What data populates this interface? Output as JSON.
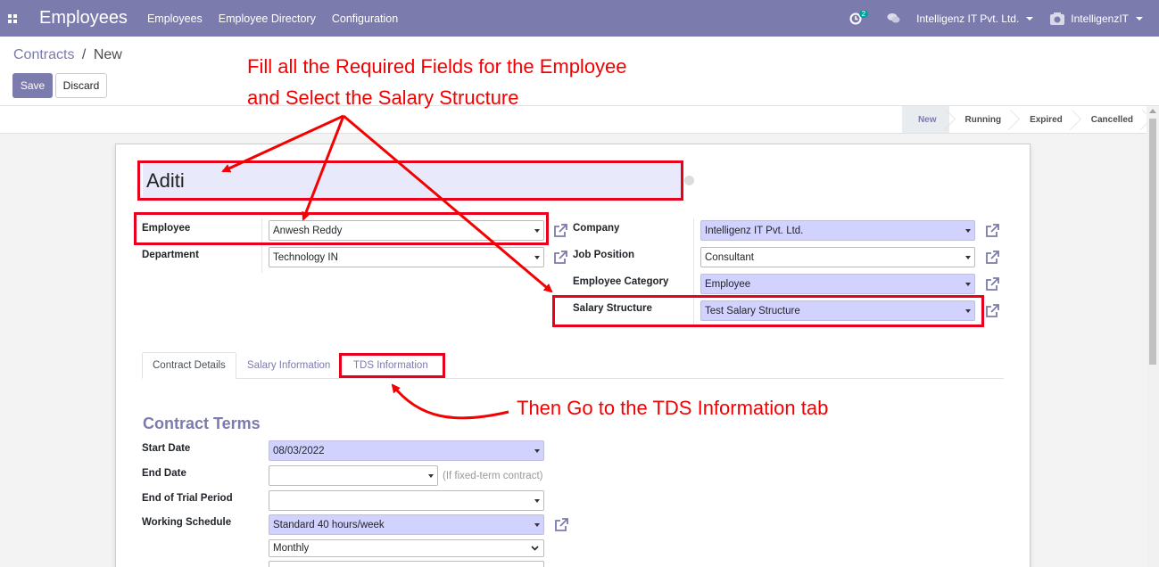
{
  "navbar": {
    "app_title": "Employees",
    "menu": [
      "Employees",
      "Employee Directory",
      "Configuration"
    ],
    "activity_badge": "2",
    "company": "Intelligenz IT Pvt. Ltd.",
    "user": "IntelligenzIT",
    "color": "#7c7bad"
  },
  "breadcrumb": {
    "parent": "Contracts",
    "separator": "/",
    "current": "New"
  },
  "buttons": {
    "save": "Save",
    "discard": "Discard"
  },
  "status_stages": [
    "New",
    "Running",
    "Expired",
    "Cancelled"
  ],
  "form": {
    "name": "Aditi",
    "employee": {
      "label": "Employee",
      "value": "Anwesh Reddy"
    },
    "department": {
      "label": "Department",
      "value": "Technology IN"
    },
    "company": {
      "label": "Company",
      "value": "Intelligenz IT Pvt. Ltd."
    },
    "job_position": {
      "label": "Job Position",
      "value": "Consultant"
    },
    "employee_category": {
      "label": "Employee Category",
      "value": "Employee"
    },
    "salary_structure": {
      "label": "Salary Structure",
      "value": "Test Salary Structure"
    }
  },
  "tabs": [
    "Contract Details",
    "Salary Information",
    "TDS Information"
  ],
  "contract_terms": {
    "title": "Contract Terms",
    "start_date": {
      "label": "Start Date",
      "value": "08/03/2022"
    },
    "end_date": {
      "label": "End Date",
      "value": "",
      "hint": "(If fixed-term contract)"
    },
    "trial_end": {
      "label": "End of Trial Period",
      "value": ""
    },
    "working_schedule": {
      "label": "Working Schedule",
      "value": "Standard 40 hours/week"
    },
    "pay_frequency": {
      "value": "Monthly"
    }
  },
  "annotations": {
    "instruction_line1": "Fill all the Required Fields for the Employee",
    "instruction_line2": "and Select the Salary Structure",
    "tab_instruction": "Then Go to the TDS Information tab",
    "color": "#f40000"
  }
}
